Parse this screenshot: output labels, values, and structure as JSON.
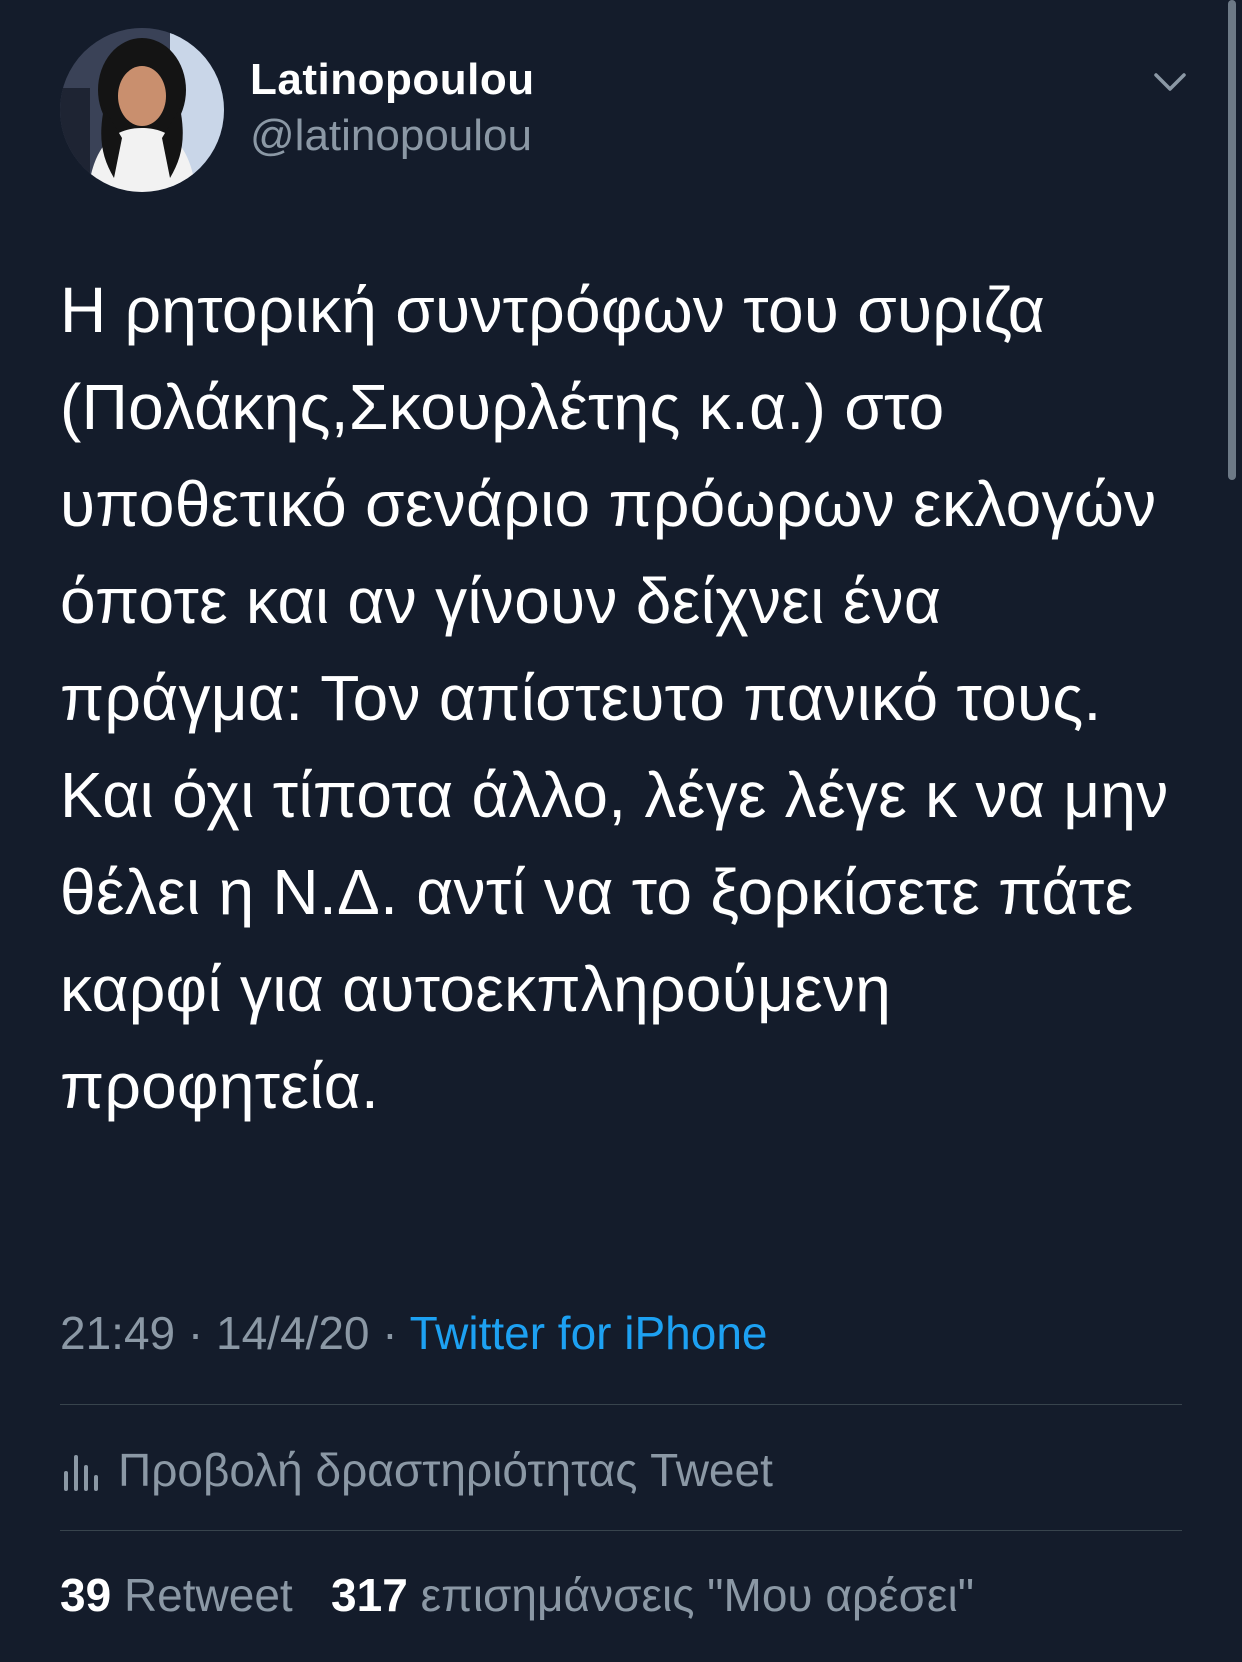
{
  "user": {
    "display_name": "Latinopoulou",
    "handle": "@latinopoulou",
    "avatar_icon": "profile-photo"
  },
  "tweet": {
    "text": "Η ρητορική συντρόφων του συριζα (Πολάκης,Σκουρλέτης κ.α.) στο υποθετικό σενάριο πρόωρων εκλογών όποτε και αν γίνουν δείχνει ένα πράγμα: Τον απίστευτο πανικό τους.\nΚαι όχι τίποτα άλλο, λέγε λέγε κ να μην θέλει η Ν.Δ. αντί να το ξορκίσετε πάτε καρφί για αυτοεκπληρούμενη προφητεία.",
    "time": "21:49",
    "date": "14/4/20",
    "separator": "·",
    "source": "Twitter for iPhone"
  },
  "activity": {
    "label": "Προβολή δραστηριότητας Tweet",
    "icon": "activity-bars-icon"
  },
  "stats": {
    "retweets_count": "39",
    "retweets_label": "Retweet",
    "likes_count": "317",
    "likes_label": "επισημάνσεις \"Μου αρέσει\""
  },
  "colors": {
    "background": "#141c2b",
    "text": "#ffffff",
    "secondary": "#8b98a5",
    "accent": "#1da1f2",
    "divider": "#38444d"
  }
}
